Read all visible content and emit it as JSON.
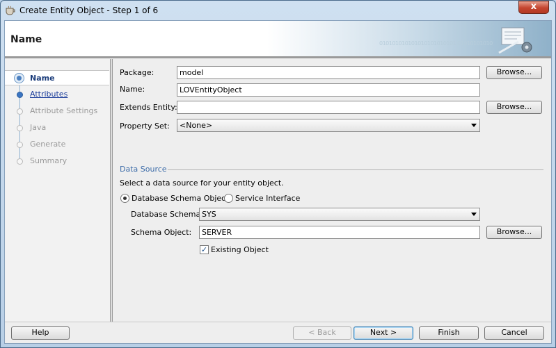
{
  "window": {
    "title": "Create Entity Object - Step 1 of 6",
    "close_glyph": "x"
  },
  "header": {
    "title": "Name",
    "binary": "010101010101010101010101 01010101010"
  },
  "nav": {
    "items": [
      {
        "label": "Name",
        "state": "active"
      },
      {
        "label": "Attributes",
        "state": "link"
      },
      {
        "label": "Attribute Settings",
        "state": "disabled"
      },
      {
        "label": "Java",
        "state": "disabled"
      },
      {
        "label": "Generate",
        "state": "disabled"
      },
      {
        "label": "Summary",
        "state": "disabled"
      }
    ]
  },
  "form": {
    "package_label": "Package:",
    "package_value": "model",
    "name_label": "Name:",
    "name_value": "LOVEntityObject",
    "extends_label": "Extends Entity:",
    "extends_value": "",
    "property_set_label": "Property Set:",
    "property_set_value": "<None>",
    "browse_label": "Browse...",
    "data_source_label": "Data Source",
    "data_source_hint": "Select a data source for your entity object.",
    "radio_db_label": "Database Schema Object",
    "radio_service_label": "Service Interface",
    "db_schema_label": "Database Schema:",
    "db_schema_value": "SYS",
    "schema_object_label": "Schema Object:",
    "schema_object_value": "SERVER",
    "existing_object_label": "Existing Object",
    "existing_object_checked": true
  },
  "footer": {
    "help": "Help",
    "back": "< Back",
    "next": "Next >",
    "finish": "Finish",
    "cancel": "Cancel"
  }
}
